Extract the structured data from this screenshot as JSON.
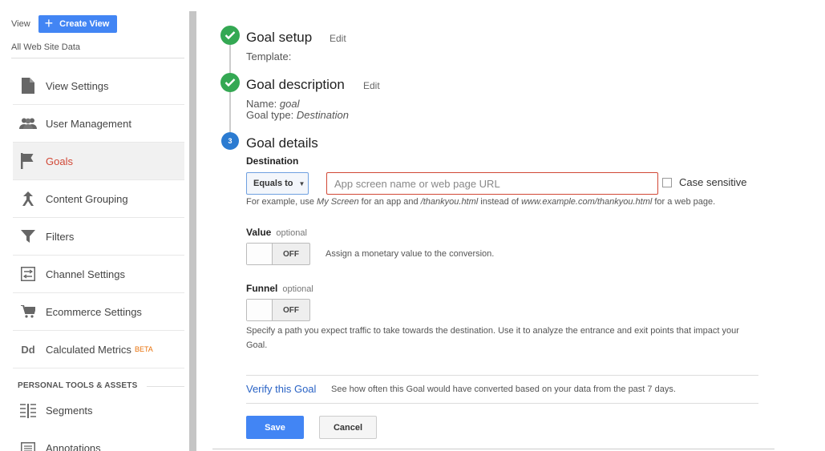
{
  "sidebar": {
    "view_label": "View",
    "create_view_label": "Create View",
    "view_name": "All Web Site Data",
    "items": [
      {
        "label": "View Settings",
        "icon": "file-icon"
      },
      {
        "label": "User Management",
        "icon": "people-icon"
      },
      {
        "label": "Goals",
        "icon": "flag-icon",
        "active": true
      },
      {
        "label": "Content Grouping",
        "icon": "content-grouping-icon"
      },
      {
        "label": "Filters",
        "icon": "filter-icon"
      },
      {
        "label": "Channel Settings",
        "icon": "channel-settings-icon"
      },
      {
        "label": "Ecommerce Settings",
        "icon": "cart-icon"
      },
      {
        "label": "Calculated Metrics",
        "icon": "dd-icon",
        "badge": "BETA"
      }
    ],
    "section_header": "PERSONAL TOOLS & ASSETS",
    "tools": [
      {
        "label": "Segments",
        "icon": "segments-icon"
      },
      {
        "label": "Annotations",
        "icon": "annotations-icon"
      }
    ]
  },
  "goal": {
    "steps": {
      "setup": {
        "title": "Goal setup",
        "edit": "Edit",
        "template_label": "Template:"
      },
      "description": {
        "title": "Goal description",
        "edit": "Edit",
        "name_label": "Name:",
        "name_value": "goal",
        "type_label": "Goal type:",
        "type_value": "Destination"
      },
      "details": {
        "title": "Goal details",
        "number": "3"
      }
    },
    "destination": {
      "label": "Destination",
      "match_type": "Equals to",
      "url_placeholder": "App screen name or web page URL",
      "case_sensitive_label": "Case sensitive",
      "example": {
        "prefix": "For example, use ",
        "app": "My Screen",
        "mid1": " for an app and ",
        "page": "/thankyou.html",
        "mid2": " instead of ",
        "full": "www.example.com/thankyou.html",
        "suffix": " for a web page."
      }
    },
    "value": {
      "label": "Value",
      "optional": "optional",
      "toggle": "OFF",
      "helper": "Assign a monetary value to the conversion."
    },
    "funnel": {
      "label": "Funnel",
      "optional": "optional",
      "toggle": "OFF",
      "helper": "Specify a path you expect traffic to take towards the destination. Use it to analyze the entrance and exit points that impact your Goal."
    },
    "verify": {
      "link": "Verify this Goal",
      "desc": "See how often this Goal would have converted based on your data from the past 7 days."
    },
    "save_label": "Save",
    "cancel_label": "Cancel"
  },
  "colors": {
    "accent": "#4285f4",
    "active_nav": "#d14836",
    "success": "#34a853",
    "step": "#2b7bd1",
    "link": "#2a63c5"
  }
}
